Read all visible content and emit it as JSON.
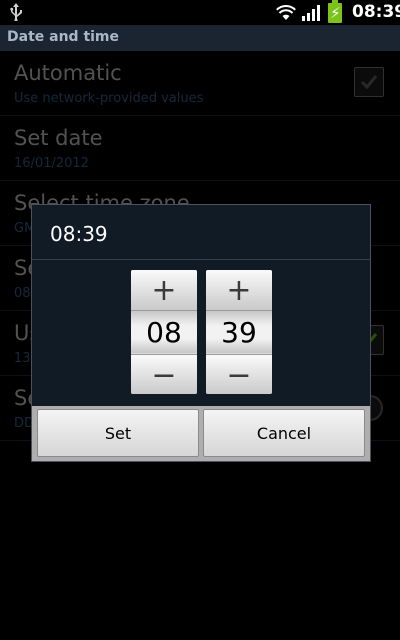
{
  "status_bar": {
    "time": "08:39",
    "icons": [
      "usb-icon",
      "wifi-icon",
      "signal-icon",
      "battery-charging-icon"
    ],
    "battery_color": "#7cc31c"
  },
  "title": "Date and time",
  "settings": [
    {
      "title": "Automatic",
      "subtitle": "Use network-provided values",
      "checked": true
    },
    {
      "title": "Set date",
      "subtitle": "16/01/2012"
    },
    {
      "title": "Select time zone",
      "subtitle": "GM"
    },
    {
      "title": "Se",
      "subtitle": "08"
    },
    {
      "title": "Us",
      "subtitle": "13"
    },
    {
      "title": "Se",
      "subtitle": "DD"
    }
  ],
  "dialog": {
    "title": "08:39",
    "hour": "08",
    "minute": "39",
    "plus_label": "+",
    "minus_label": "−",
    "set_label": "Set",
    "cancel_label": "Cancel"
  },
  "colors": {
    "accent_subtitle": "#2f5a84",
    "title_bar": "#1b2431",
    "dialog_bg": "#111b26"
  }
}
